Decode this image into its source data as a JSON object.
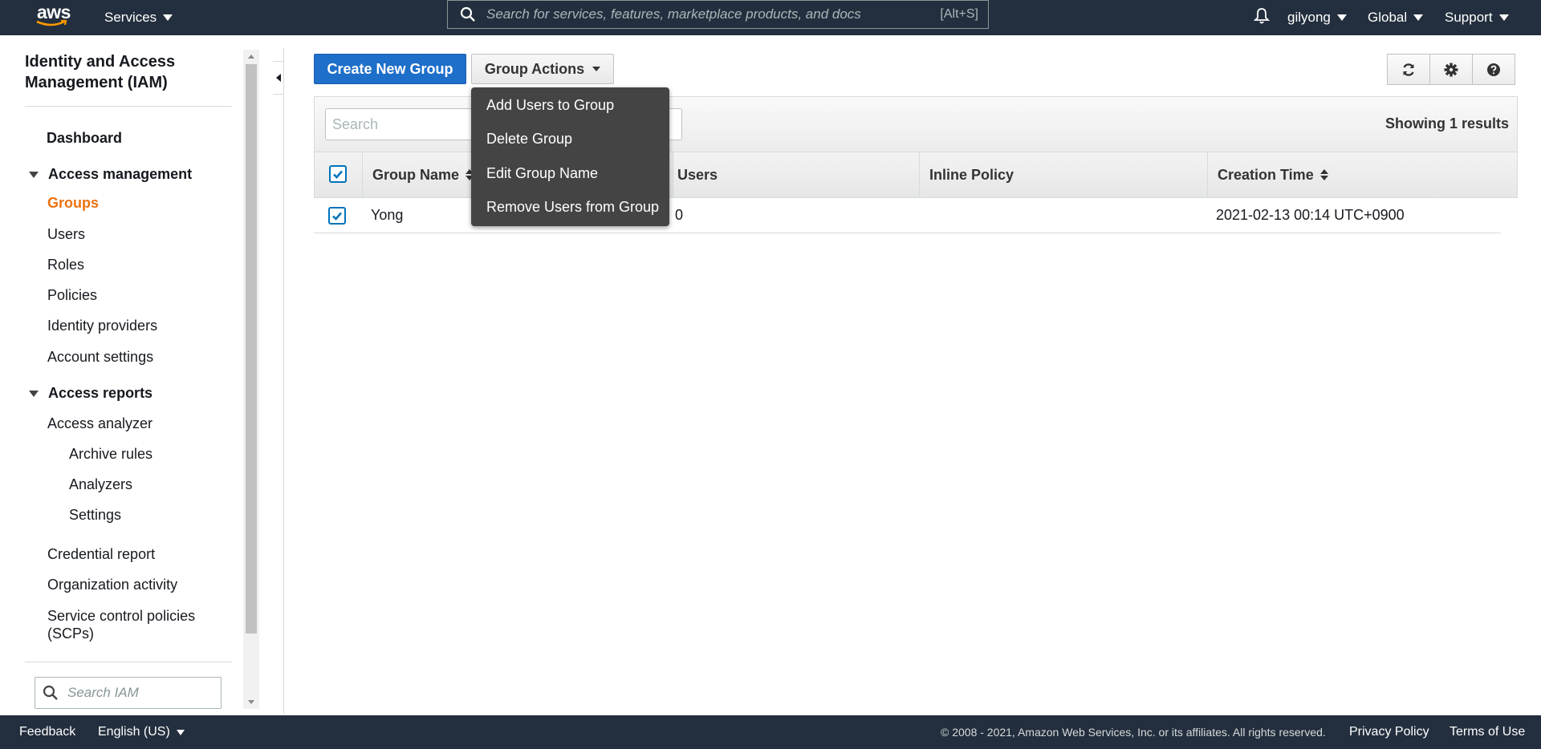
{
  "topnav": {
    "logo_text": "aws",
    "services_label": "Services",
    "search_placeholder": "Search for services, features, marketplace products, and docs",
    "search_shortcut": "[Alt+S]",
    "user_label": "gilyong",
    "region_label": "Global",
    "support_label": "Support"
  },
  "sidebar": {
    "title": "Identity and Access Management (IAM)",
    "dashboard": "Dashboard",
    "access_management": {
      "label": "Access management",
      "items": [
        "Groups",
        "Users",
        "Roles",
        "Policies",
        "Identity providers",
        "Account settings"
      ],
      "active": "Groups"
    },
    "access_reports": {
      "label": "Access reports",
      "analyzer": "Access analyzer",
      "analyzer_sub": [
        "Archive rules",
        "Analyzers",
        "Settings"
      ],
      "items": [
        "Credential report",
        "Organization activity",
        "Service control policies (SCPs)"
      ]
    },
    "search_placeholder": "Search IAM"
  },
  "toolbar": {
    "create_label": "Create New Group",
    "actions_label": "Group Actions",
    "refresh_icon": "refresh-icon",
    "settings_icon": "gear-icon",
    "help_icon": "help-icon"
  },
  "table": {
    "search_placeholder": "Search",
    "results_text": "Showing 1 results",
    "columns": [
      "Group Name",
      "Users",
      "Inline Policy",
      "Creation Time"
    ],
    "rows": [
      {
        "group_name": "Yong",
        "users": "0",
        "inline_policy": "",
        "creation_time": "2021-02-13 00:14 UTC+0900",
        "checked": true
      }
    ],
    "select_all_checked": true
  },
  "dropdown": {
    "items": [
      "Add Users to Group",
      "Delete Group",
      "Edit Group Name",
      "Remove Users from Group"
    ]
  },
  "footer": {
    "feedback": "Feedback",
    "language": "English (US)",
    "copyright": "© 2008 - 2021, Amazon Web Services, Inc. or its affiliates. All rights reserved.",
    "privacy": "Privacy Policy",
    "terms": "Terms of Use"
  },
  "colors": {
    "nav_bg": "#232f3e",
    "primary": "#1e6fc9",
    "active_link": "#ec7211",
    "checkbox": "#0073bb"
  }
}
